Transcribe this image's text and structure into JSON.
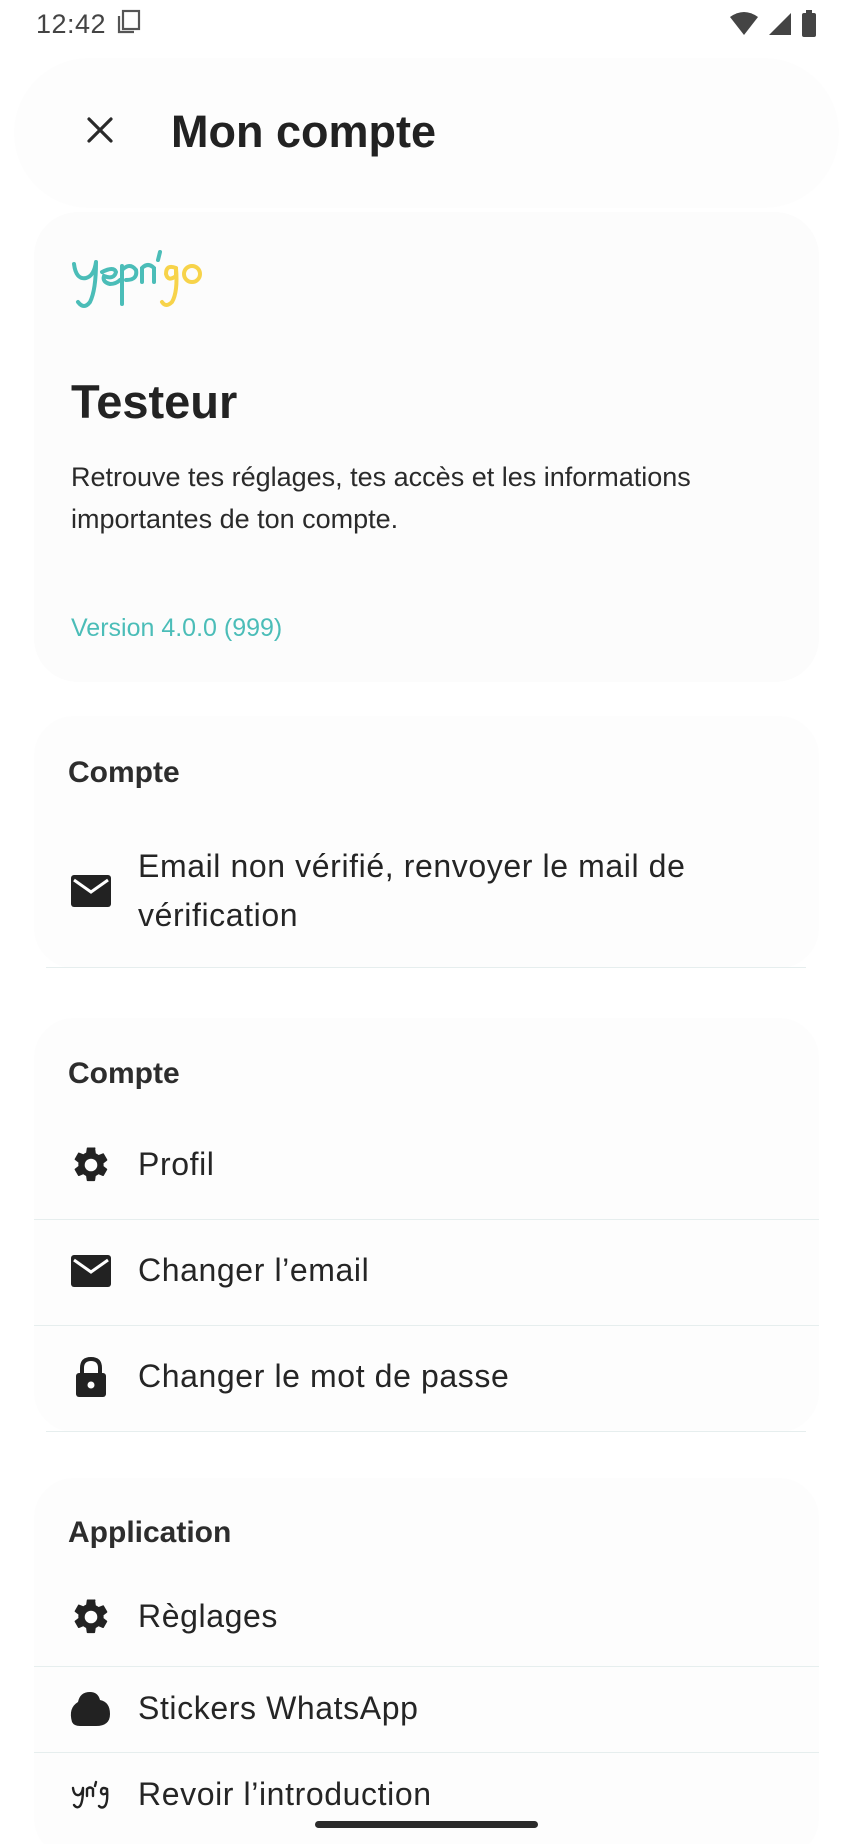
{
  "status_bar": {
    "time": "12:42"
  },
  "app_bar": {
    "title": "Mon compte",
    "close_icon": "close-icon"
  },
  "header": {
    "logo_text": "yepn'go",
    "user_name": "Testeur",
    "description": "Retrouve tes réglages, tes accès et les informations importantes de ton compte.",
    "version": "Version 4.0.0 (999)"
  },
  "sections": [
    {
      "title": "Compte",
      "items": [
        {
          "label": "Email non vérifié, renvoyer le mail de vérification",
          "icon": "mail-icon"
        }
      ]
    },
    {
      "title": "Compte",
      "items": [
        {
          "label": "Profil",
          "icon": "gear-icon"
        },
        {
          "label": "Changer l’email",
          "icon": "mail-icon"
        },
        {
          "label": "Changer le mot de passe",
          "icon": "lock-icon"
        }
      ]
    },
    {
      "title": "Application",
      "items": [
        {
          "label": "Règlages",
          "icon": "gear-icon"
        },
        {
          "label": "Stickers WhatsApp",
          "icon": "sticker-icon"
        },
        {
          "label": "Revoir l’introduction",
          "icon": "yng-logo-icon"
        }
      ]
    }
  ],
  "colors": {
    "accent_teal": "#4bbdb8",
    "accent_yellow": "#f7d34a",
    "text_primary": "#222222",
    "divider": "#e6eeee"
  }
}
